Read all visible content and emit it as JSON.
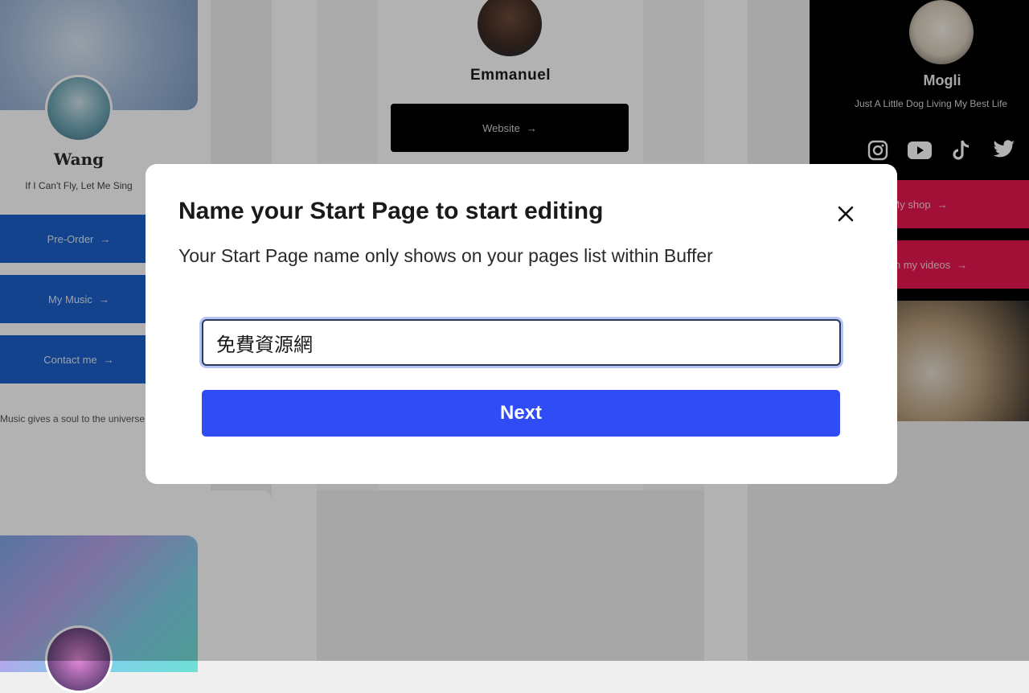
{
  "background": {
    "wang": {
      "name": "Wang",
      "tagline": "If I Can't Fly, Let Me Sing",
      "buttons": [
        "Pre-Order",
        "My Music",
        "Contact me"
      ],
      "quote": "Music gives a soul to the universe"
    },
    "emmanuel": {
      "name": "Emmanuel",
      "button": "Website"
    },
    "mogli": {
      "name": "Mogli",
      "tagline": "Just A Little Dog Living My Best Life",
      "social_icons": [
        "instagram-icon",
        "youtube-icon",
        "tiktok-icon",
        "twitter-icon"
      ],
      "buttons": [
        "My shop",
        "Watch my videos"
      ]
    }
  },
  "modal": {
    "title": "Name your Start Page to start editing",
    "subtitle": "Your Start Page name only shows on your pages list within Buffer",
    "input_value": "免費資源網",
    "next_label": "Next",
    "accent": "#2f4cf5"
  }
}
